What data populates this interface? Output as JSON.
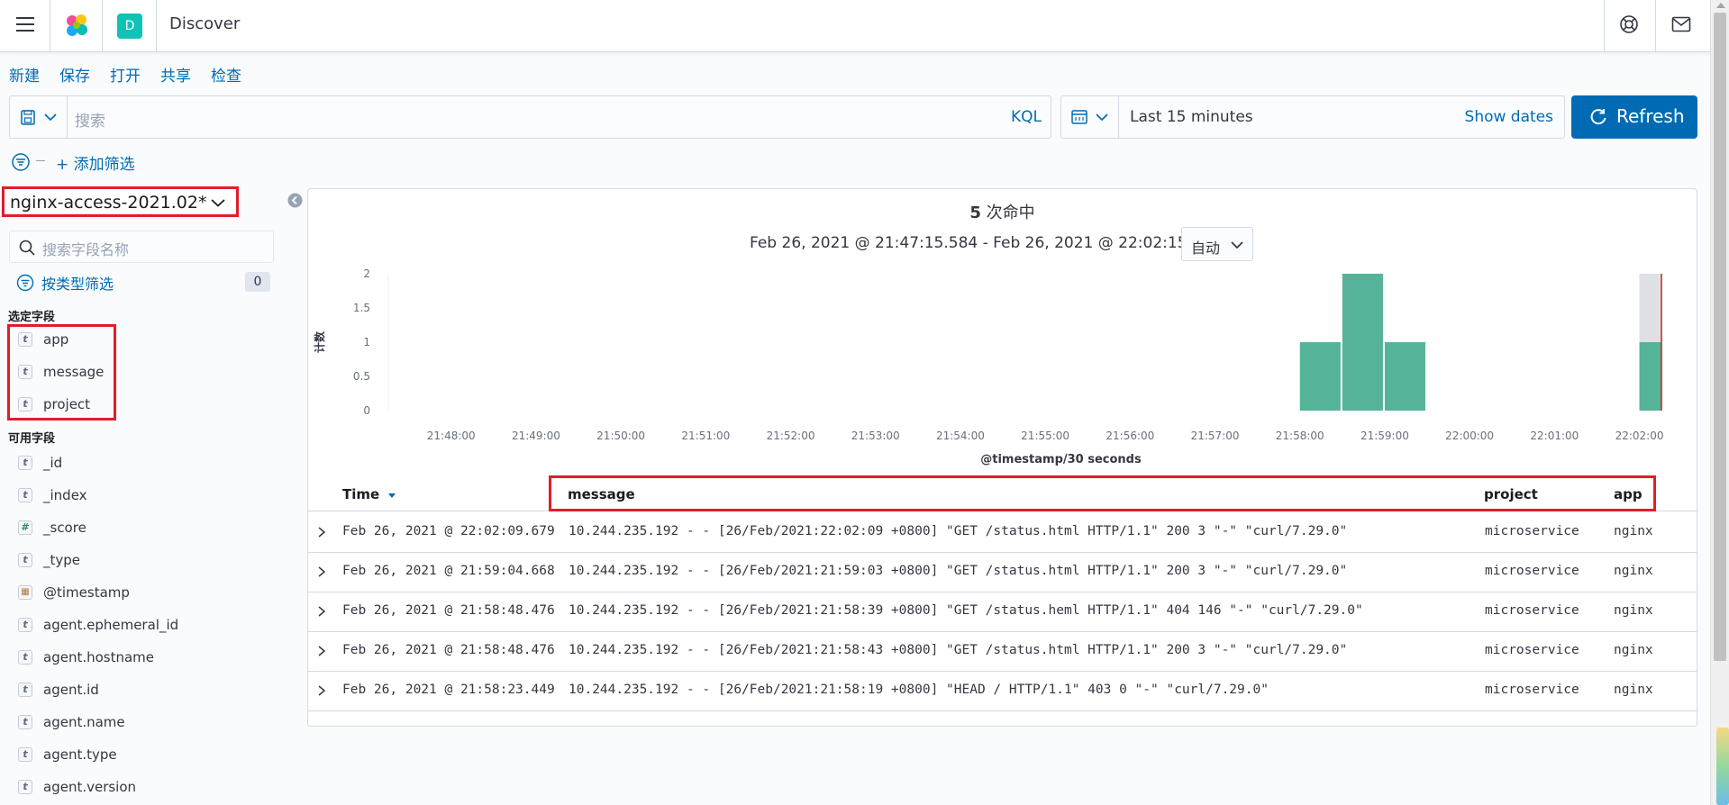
{
  "header": {
    "space_initial": "D",
    "app_title": "Discover"
  },
  "topnav": [
    "新建",
    "保存",
    "打开",
    "共享",
    "检查"
  ],
  "query": {
    "placeholder": "搜索",
    "language": "KQL"
  },
  "time": {
    "range": "Last 15 minutes",
    "show_dates": "Show dates",
    "refresh": "Refresh"
  },
  "filter": {
    "add": "+ 添加筛选"
  },
  "sidebar": {
    "index_pattern": "nginx-access-2021.02*",
    "search_placeholder": "搜索字段名称",
    "type_filter": "按类型筛选",
    "type_filter_count": "0",
    "selected_title": "选定字段",
    "selected_fields": [
      {
        "type": "t",
        "name": "app"
      },
      {
        "type": "t",
        "name": "message"
      },
      {
        "type": "t",
        "name": "project"
      }
    ],
    "available_title": "可用字段",
    "available_fields": [
      {
        "type": "t",
        "name": "_id"
      },
      {
        "type": "t",
        "name": "_index"
      },
      {
        "type": "#",
        "name": "_score"
      },
      {
        "type": "t",
        "name": "_type"
      },
      {
        "type": "date",
        "name": "@timestamp"
      },
      {
        "type": "t",
        "name": "agent.ephemeral_id"
      },
      {
        "type": "t",
        "name": "agent.hostname"
      },
      {
        "type": "t",
        "name": "agent.id"
      },
      {
        "type": "t",
        "name": "agent.name"
      },
      {
        "type": "t",
        "name": "agent.type"
      },
      {
        "type": "t",
        "name": "agent.version"
      }
    ]
  },
  "results": {
    "hit_count": "5",
    "hit_label": " 次命中",
    "range_text": "Feb 26, 2021 @ 21:47:15.584 - Feb 26, 2021 @ 22:02:15.584",
    "interval": "自动"
  },
  "chart_data": {
    "type": "bar",
    "ylabel": "计数",
    "xlabel": "@timestamp/30 seconds",
    "ylim": [
      0,
      2
    ],
    "yticks": [
      "0",
      "0.5",
      "1",
      "1.5",
      "2"
    ],
    "xticks": [
      "21:48:00",
      "21:49:00",
      "21:50:00",
      "21:51:00",
      "21:52:00",
      "21:53:00",
      "21:54:00",
      "21:55:00",
      "21:56:00",
      "21:57:00",
      "21:58:00",
      "21:59:00",
      "22:00:00",
      "22:01:00",
      "22:02:00"
    ],
    "bars": [
      {
        "x": "21:58:00",
        "value": 1
      },
      {
        "x": "21:58:30",
        "value": 2
      },
      {
        "x": "21:59:00",
        "value": 1
      },
      {
        "x": "22:02:00",
        "value": 1
      }
    ],
    "bar_color": "#54b399",
    "current_time_marker": "22:02:15.584"
  },
  "table": {
    "headers": {
      "time": "Time",
      "message": "message",
      "project": "project",
      "app": "app"
    },
    "rows": [
      {
        "time": "Feb 26, 2021 @ 22:02:09.679",
        "message": "10.244.235.192 - - [26/Feb/2021:22:02:09 +0800] \"GET /status.html HTTP/1.1\" 200 3 \"-\" \"curl/7.29.0\"",
        "project": "microservice",
        "app": "nginx"
      },
      {
        "time": "Feb 26, 2021 @ 21:59:04.668",
        "message": "10.244.235.192 - - [26/Feb/2021:21:59:03 +0800] \"GET /status.html HTTP/1.1\" 200 3 \"-\" \"curl/7.29.0\"",
        "project": "microservice",
        "app": "nginx"
      },
      {
        "time": "Feb 26, 2021 @ 21:58:48.476",
        "message": "10.244.235.192 - - [26/Feb/2021:21:58:39 +0800] \"GET /status.heml HTTP/1.1\" 404 146 \"-\" \"curl/7.29.0\"",
        "project": "microservice",
        "app": "nginx"
      },
      {
        "time": "Feb 26, 2021 @ 21:58:48.476",
        "message": "10.244.235.192 - - [26/Feb/2021:21:58:43 +0800] \"GET /status.html HTTP/1.1\" 200 3 \"-\" \"curl/7.29.0\"",
        "project": "microservice",
        "app": "nginx"
      },
      {
        "time": "Feb 26, 2021 @ 21:58:23.449",
        "message": "10.244.235.192 - - [26/Feb/2021:21:58:19 +0800] \"HEAD / HTTP/1.1\" 403 0 \"-\" \"curl/7.29.0\"",
        "project": "microservice",
        "app": "nginx"
      }
    ]
  }
}
